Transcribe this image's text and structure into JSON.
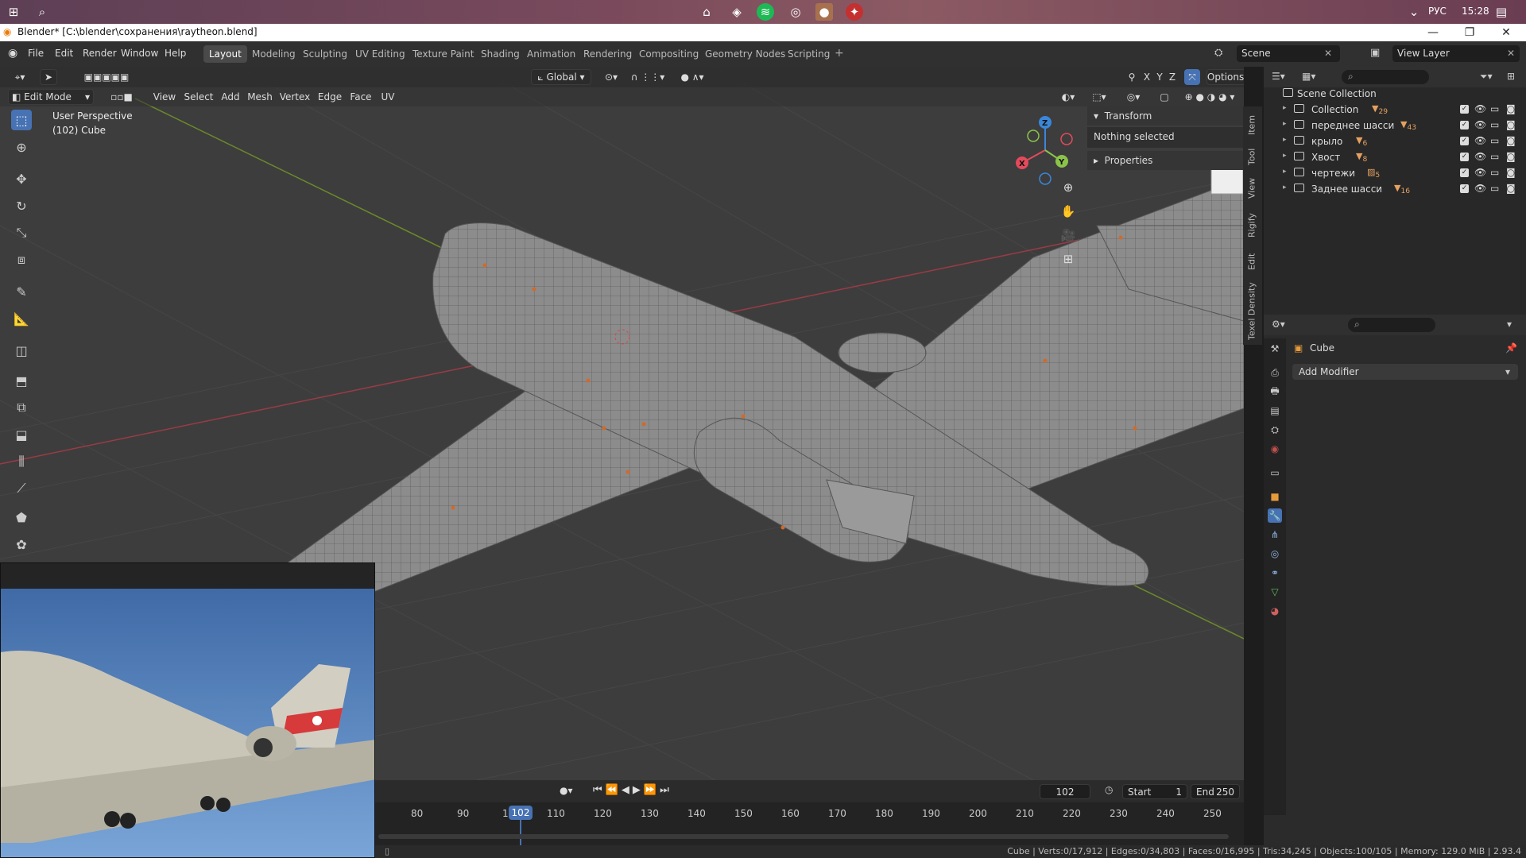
{
  "taskbar": {
    "lang": "РУС",
    "time": "15:28"
  },
  "window": {
    "title": "Blender* [C:\\blender\\сохранения\\raytheon.blend]"
  },
  "menu": [
    "File",
    "Edit",
    "Render",
    "Window",
    "Help"
  ],
  "workspaces": [
    "Layout",
    "Modeling",
    "Sculpting",
    "UV Editing",
    "Texture Paint",
    "Shading",
    "Animation",
    "Rendering",
    "Compositing",
    "Geometry Nodes",
    "Scripting"
  ],
  "active_workspace": "Layout",
  "scene": {
    "label": "Scene",
    "view_layer": "View Layer"
  },
  "viewport": {
    "orientation": "Global",
    "options": "Options",
    "mode": "Edit Mode",
    "menus": [
      "View",
      "Select",
      "Add",
      "Mesh",
      "Vertex",
      "Edge",
      "Face",
      "UV"
    ],
    "perspective": "User Perspective",
    "object_info": "(102) Cube",
    "axis": {
      "x": "X",
      "y": "Y",
      "z": "Z"
    }
  },
  "npanel": {
    "transform": "Transform",
    "nothing_selected": "Nothing selected",
    "properties": "Properties",
    "tabs": [
      "Item",
      "Tool",
      "View",
      "Rigify",
      "Edit",
      "Texel Density"
    ]
  },
  "timeline": {
    "current_frame": "102",
    "start_label": "Start",
    "start": "1",
    "end_label": "End",
    "end": "250",
    "ticks": [
      "80",
      "90",
      "1",
      "110",
      "120",
      "130",
      "140",
      "150",
      "160",
      "170",
      "180",
      "190",
      "200",
      "210",
      "220",
      "230",
      "240",
      "250"
    ]
  },
  "status": "Cube | Verts:0/17,912 | Edges:0/34,803 | Faces:0/16,995 | Tris:34,245 | Objects:100/105 | Memory: 129.0 MiB | 2.93.4",
  "outliner": {
    "root": "Scene Collection",
    "items": [
      {
        "name": "Collection",
        "count": "29"
      },
      {
        "name": "переднее шасси",
        "count": "43"
      },
      {
        "name": "крыло",
        "count": "6"
      },
      {
        "name": "Хвост",
        "count": "8"
      },
      {
        "name": "чертежи",
        "count": "5"
      },
      {
        "name": "Заднее шасси",
        "count": "16"
      }
    ]
  },
  "properties": {
    "object": "Cube",
    "add_modifier": "Add Modifier"
  },
  "colors": {
    "accent": "#4772b3",
    "axis_x": "#e34a5c",
    "axis_y": "#8bc34a",
    "axis_z": "#3a87d9",
    "orange": "#e6a060"
  }
}
